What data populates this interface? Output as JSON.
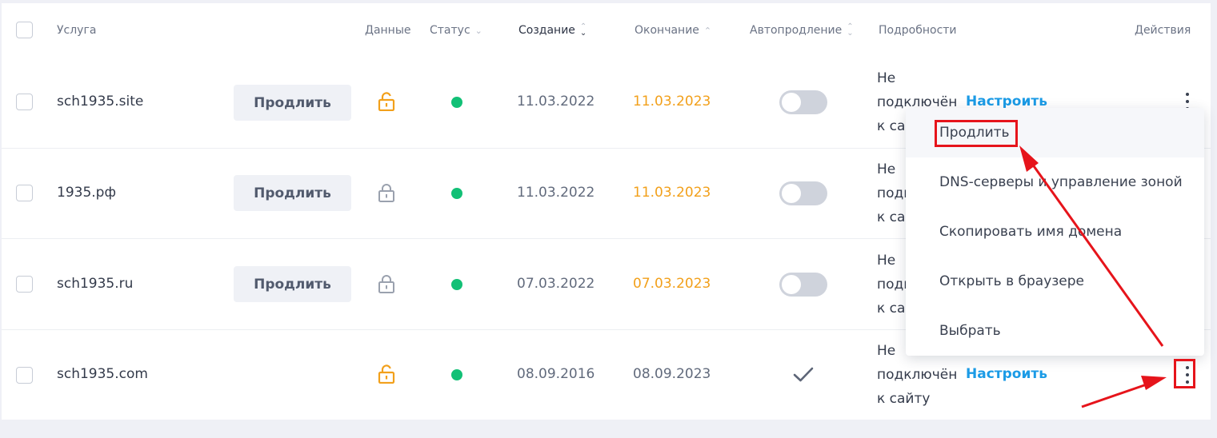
{
  "header": {
    "select_all": "",
    "service": "Услуга",
    "data": "Данные",
    "status": "Статус",
    "created": "Создание",
    "expires": "Окончание",
    "autorenew": "Автопродление",
    "details": "Подробности",
    "actions": "Действия"
  },
  "rows": [
    {
      "service": "sch1935.site",
      "renew_label": "Продлить",
      "lock": "unlocked",
      "created": "11.03.2022",
      "expires": "11.03.2023",
      "expires_warning": true,
      "autorenew": "off",
      "details": [
        "Не",
        "подключён",
        "к сайту"
      ],
      "configure": "Настроить"
    },
    {
      "service": "1935.рф",
      "renew_label": "Продлить",
      "lock": "locked",
      "created": "11.03.2022",
      "expires": "11.03.2023",
      "expires_warning": true,
      "autorenew": "off",
      "details": [
        "Не",
        "подключён",
        "к сайту"
      ]
    },
    {
      "service": "sch1935.ru",
      "renew_label": "Продлить",
      "lock": "locked",
      "created": "07.03.2022",
      "expires": "07.03.2023",
      "expires_warning": true,
      "autorenew": "off",
      "details": [
        "Не",
        "подключён",
        "к сайту"
      ]
    },
    {
      "service": "sch1935.com",
      "lock": "unlocked",
      "created": "08.09.2016",
      "expires": "08.09.2023",
      "expires_warning": false,
      "autorenew": "check",
      "details": [
        "Не",
        "подключён",
        "к сайту"
      ],
      "configure": "Настроить"
    }
  ],
  "menu": {
    "items": [
      "Продлить",
      "DNS-серверы и управление зоной",
      "Скопировать имя домена",
      "Открыть в браузере",
      "Выбрать"
    ],
    "highlighted": 0
  },
  "colors": {
    "status_active": "#12c076",
    "expiry_warning": "#f2a01b",
    "link": "#1b9be6",
    "annotation": "#e6141b",
    "unlocked_icon": "#f2a01b",
    "locked_icon": "#9aa1ae"
  },
  "icons": {
    "lock_open": "lock-open-icon",
    "lock_closed": "lock-closed-icon",
    "kebab": "more-vertical-icon",
    "check": "check-icon",
    "sort": "sort-icon"
  }
}
